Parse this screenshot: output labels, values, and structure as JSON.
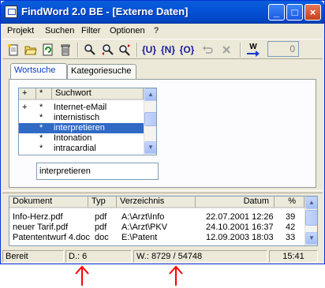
{
  "window": {
    "title": "FindWord 2.0 BE - [Externe Daten]"
  },
  "titlebar_buttons": {
    "minimize": "_",
    "maximize": "□",
    "close": "×"
  },
  "menu": [
    {
      "label": "Projekt"
    },
    {
      "label": "Suchen"
    },
    {
      "label": "Filter"
    },
    {
      "label": "Optionen"
    },
    {
      "label": "?"
    }
  ],
  "toolbar": {
    "icons": [
      "new-document-icon",
      "open-folder-icon",
      "refresh-icon",
      "trash-icon",
      "search-icon",
      "search-previous-icon",
      "search-next-icon",
      "u-filter-icon",
      "n-filter-icon",
      "o-filter-icon",
      "undo-icon",
      "cancel-icon",
      "word-count-icon"
    ],
    "u_label": "{U}",
    "n_label": "{N}",
    "o_label": "{O}",
    "w_label": "W",
    "counter_value": "0"
  },
  "tabs": [
    {
      "label": "Wortsuche",
      "active": true
    },
    {
      "label": "Kategoriesuche",
      "active": false
    }
  ],
  "wordlist": {
    "headers": {
      "plus": "+",
      "star": "*",
      "word": "Suchwort"
    },
    "rows": [
      {
        "plus": "+",
        "star": "*",
        "word": "Internet-eMail",
        "selected": false
      },
      {
        "plus": "",
        "star": "*",
        "word": "internistisch",
        "selected": false
      },
      {
        "plus": "",
        "star": "*",
        "word": "interpretieren",
        "selected": true
      },
      {
        "plus": "",
        "star": "*",
        "word": "Intonation",
        "selected": false
      },
      {
        "plus": "",
        "star": "*",
        "word": "intracardial",
        "selected": false
      }
    ]
  },
  "search": {
    "value": "interpretieren"
  },
  "results": {
    "headers": {
      "document": "Dokument",
      "type": "Typ",
      "directory": "Verzeichnis",
      "date": "Datum",
      "percent": "%"
    },
    "rows": [
      {
        "document": "Info-Herz.pdf",
        "type": "pdf",
        "directory": "A:\\Arzt\\Info",
        "date": "22.07.2001 12:26",
        "percent": "39"
      },
      {
        "document": "neuer Tarif.pdf",
        "type": "pdf",
        "directory": "A:\\Arzt\\PKV",
        "date": "24.10.2001 16:37",
        "percent": "42"
      },
      {
        "document": "Patententwurf 4.doc",
        "type": "doc",
        "directory": "E:\\Patent",
        "date": "12.09.2003 18:03",
        "percent": "33"
      }
    ]
  },
  "status": {
    "state": "Bereit",
    "documents": "D.: 6",
    "words": "W.: 8729 / 54748",
    "time": "15:41"
  },
  "colors": {
    "titlebar": "#0553d9",
    "selection": "#316ac5",
    "annotation_arrow": "#ff0000"
  }
}
